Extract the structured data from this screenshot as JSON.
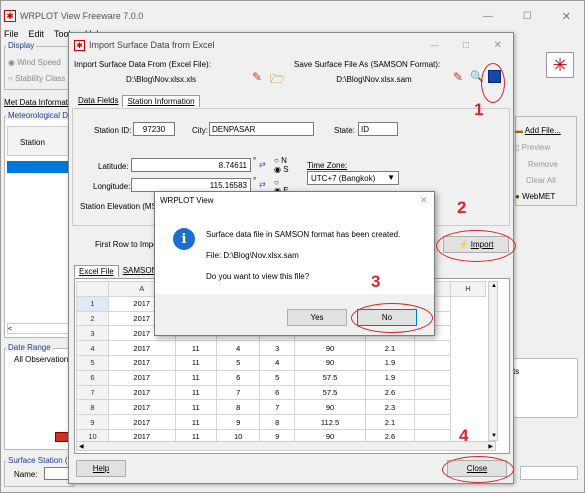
{
  "main": {
    "title": "WRPLOT View Freeware 7.0.0",
    "menu": [
      "File",
      "Edit",
      "Tools",
      "Help"
    ],
    "display": "Display",
    "wind_speed": "Wind Speed",
    "stability": "Stability Class",
    "met_tab": "Met Data Informatic",
    "met_group": "Meteorological Da",
    "station_hdr": "Station",
    "date_range": "Date Range",
    "all_obs": "All Observation",
    "surface_station": "Surface Station (C",
    "name_label": "Name:",
    "right_buttons": [
      "Add File...",
      "Preview",
      "Remove",
      "Clear All",
      "WebMET"
    ],
    "right_cut": "ts"
  },
  "dialog": {
    "title": "Import Surface Data from Excel",
    "import_label": "Import Surface Data From (Excel File):",
    "import_file": "D:\\Blog\\Nov.xlsx.xls",
    "save_label": "Save Surface File As (SAMSON Format):",
    "save_file": "D:\\Blog\\Nov.xlsx.sam",
    "tabs": [
      "Data Fields",
      "Station Information"
    ],
    "station_id_label": "Station ID:",
    "station_id": "97230",
    "city_label": "City:",
    "city": "DENPASAR",
    "state_label": "State:",
    "state": "ID",
    "lat_label": "Latitude:",
    "lat": "8.74611",
    "lon_label": "Longitude:",
    "lon": "115.16583",
    "deg": "°",
    "ns": [
      "N",
      "S"
    ],
    "ew": [
      "E"
    ],
    "tz_label": "Time Zone:",
    "tz": "UTC+7 (Bangkok)",
    "elev_label": "Station Elevation (MS",
    "first_row": "First Row to Impo",
    "import_btn": "Import",
    "sheet_tabs": [
      "Excel File",
      "SAMSON F"
    ],
    "cols": [
      "A",
      "B",
      "C",
      "D",
      "E",
      "F",
      "G",
      "H"
    ],
    "rows": [
      [
        "1",
        "2017",
        "",
        "",
        "",
        "",
        "",
        ""
      ],
      [
        "2",
        "2017",
        "",
        "",
        "",
        "",
        "",
        ""
      ],
      [
        "3",
        "2017",
        "",
        "",
        "",
        "",
        "",
        ""
      ],
      [
        "4",
        "2017",
        "11",
        "4",
        "3",
        "90",
        "2.1",
        ""
      ],
      [
        "5",
        "2017",
        "11",
        "5",
        "4",
        "90",
        "1.9",
        ""
      ],
      [
        "6",
        "2017",
        "11",
        "6",
        "5",
        "57.5",
        "1.9",
        ""
      ],
      [
        "7",
        "2017",
        "11",
        "7",
        "6",
        "57.5",
        "2.6",
        ""
      ],
      [
        "8",
        "2017",
        "11",
        "8",
        "7",
        "90",
        "2.3",
        ""
      ],
      [
        "9",
        "2017",
        "11",
        "9",
        "8",
        "112.5",
        "2.1",
        ""
      ],
      [
        "10",
        "2017",
        "11",
        "10",
        "9",
        "90",
        "2.6",
        ""
      ]
    ],
    "help": "Help",
    "close": "Close"
  },
  "msg": {
    "title": "WRPLOT View",
    "line1": "Surface data file in SAMSON format has been created.",
    "line2": "File: D:\\Blog\\Nov.xlsx.sam",
    "line3": "Do you want to view this file?",
    "yes": "Yes",
    "no": "No"
  },
  "annotations": [
    "1",
    "2",
    "3",
    "4"
  ]
}
